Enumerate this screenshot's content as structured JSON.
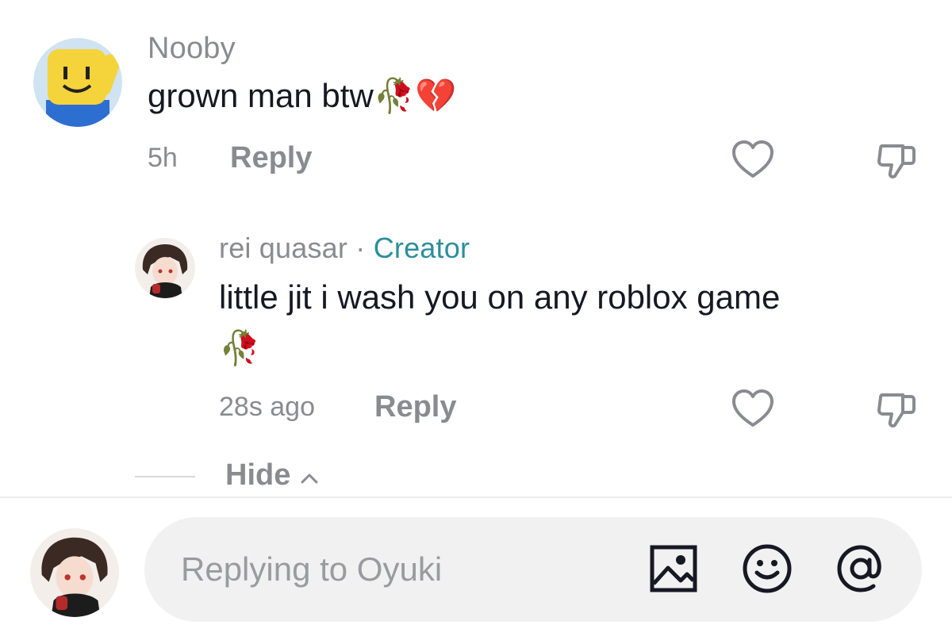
{
  "comments": [
    {
      "username": "Nooby",
      "text": "grown man btw",
      "emoji": "🥀💔",
      "time": "5h",
      "reply_label": "Reply"
    },
    {
      "username": "rei quasar",
      "separator": "·",
      "creator_label": "Creator",
      "text": "little jit i wash you on any roblox game",
      "emoji": "🥀",
      "time": "28s ago",
      "reply_label": "Reply"
    }
  ],
  "thread": {
    "hide_label": "Hide"
  },
  "composer": {
    "placeholder": "Replying to Oyuki"
  },
  "icons": {
    "like": "heart-icon",
    "dislike": "thumbs-down-icon",
    "image": "image-icon",
    "emoji": "smiley-icon",
    "mention": "at-icon",
    "hide": "chevron-up-icon"
  },
  "colors": {
    "creator": "#2a8f9a",
    "muted": "#8a8b91",
    "text": "#161823"
  }
}
